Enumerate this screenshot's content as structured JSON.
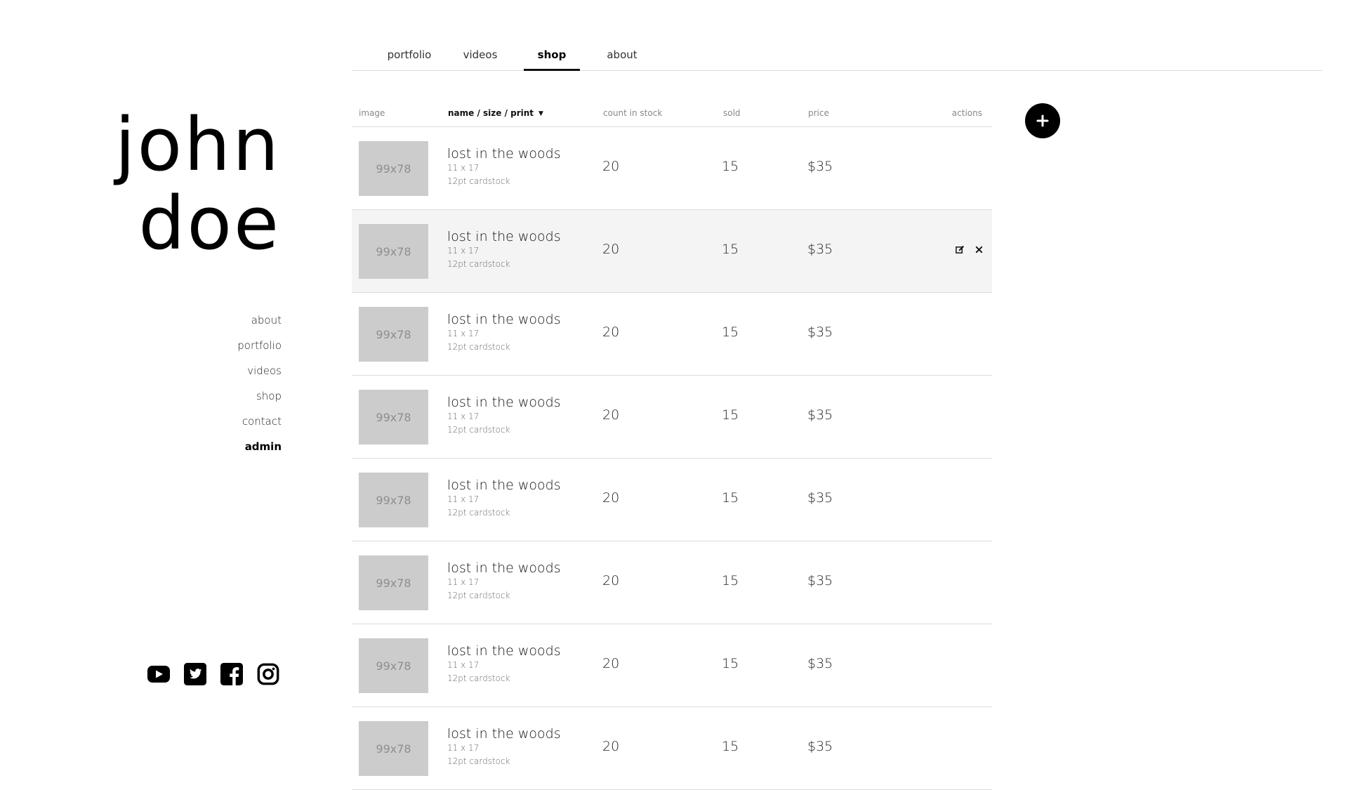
{
  "site": {
    "name_line1": "john",
    "name_line2": "doe"
  },
  "side_nav": [
    {
      "label": "about"
    },
    {
      "label": "portfolio"
    },
    {
      "label": "videos"
    },
    {
      "label": "shop"
    },
    {
      "label": "contact"
    },
    {
      "label": "admin",
      "active": true
    }
  ],
  "social": [
    "youtube-icon",
    "twitter-icon",
    "facebook-icon",
    "instagram-icon"
  ],
  "tabs": [
    {
      "label": "portfolio"
    },
    {
      "label": "videos"
    },
    {
      "label": "shop",
      "active": true
    },
    {
      "label": "about"
    }
  ],
  "table": {
    "headers": {
      "image": "image",
      "name": "name / size / print",
      "count": "count in stock",
      "sold": "sold",
      "price": "price",
      "actions": "actions"
    },
    "sort_icon": "caret-down-icon",
    "row_action_icons": [
      "edit-icon",
      "delete-icon"
    ],
    "rows": [
      {
        "thumb": "99x78",
        "name": "lost in the woods",
        "size": "11 x 17",
        "print": "12pt cardstock",
        "count": "20",
        "sold": "15",
        "price": "$35"
      },
      {
        "thumb": "99x78",
        "name": "lost in the woods",
        "size": "11 x 17",
        "print": "12pt cardstock",
        "count": "20",
        "sold": "15",
        "price": "$35",
        "hovered": true
      },
      {
        "thumb": "99x78",
        "name": "lost in the woods",
        "size": "11 x 17",
        "print": "12pt cardstock",
        "count": "20",
        "sold": "15",
        "price": "$35"
      },
      {
        "thumb": "99x78",
        "name": "lost in the woods",
        "size": "11 x 17",
        "print": "12pt cardstock",
        "count": "20",
        "sold": "15",
        "price": "$35"
      },
      {
        "thumb": "99x78",
        "name": "lost in the woods",
        "size": "11 x 17",
        "print": "12pt cardstock",
        "count": "20",
        "sold": "15",
        "price": "$35"
      },
      {
        "thumb": "99x78",
        "name": "lost in the woods",
        "size": "11 x 17",
        "print": "12pt cardstock",
        "count": "20",
        "sold": "15",
        "price": "$35"
      },
      {
        "thumb": "99x78",
        "name": "lost in the woods",
        "size": "11 x 17",
        "print": "12pt cardstock",
        "count": "20",
        "sold": "15",
        "price": "$35"
      },
      {
        "thumb": "99x78",
        "name": "lost in the woods",
        "size": "11 x 17",
        "print": "12pt cardstock",
        "count": "20",
        "sold": "15",
        "price": "$35"
      }
    ]
  },
  "add_button_icon": "plus-icon",
  "colors": {
    "text": "#111111",
    "thumb_bg": "#cccccc",
    "hover_row": "#f4f4f4",
    "divider": "#dcdcdc",
    "accent": "#000000"
  }
}
